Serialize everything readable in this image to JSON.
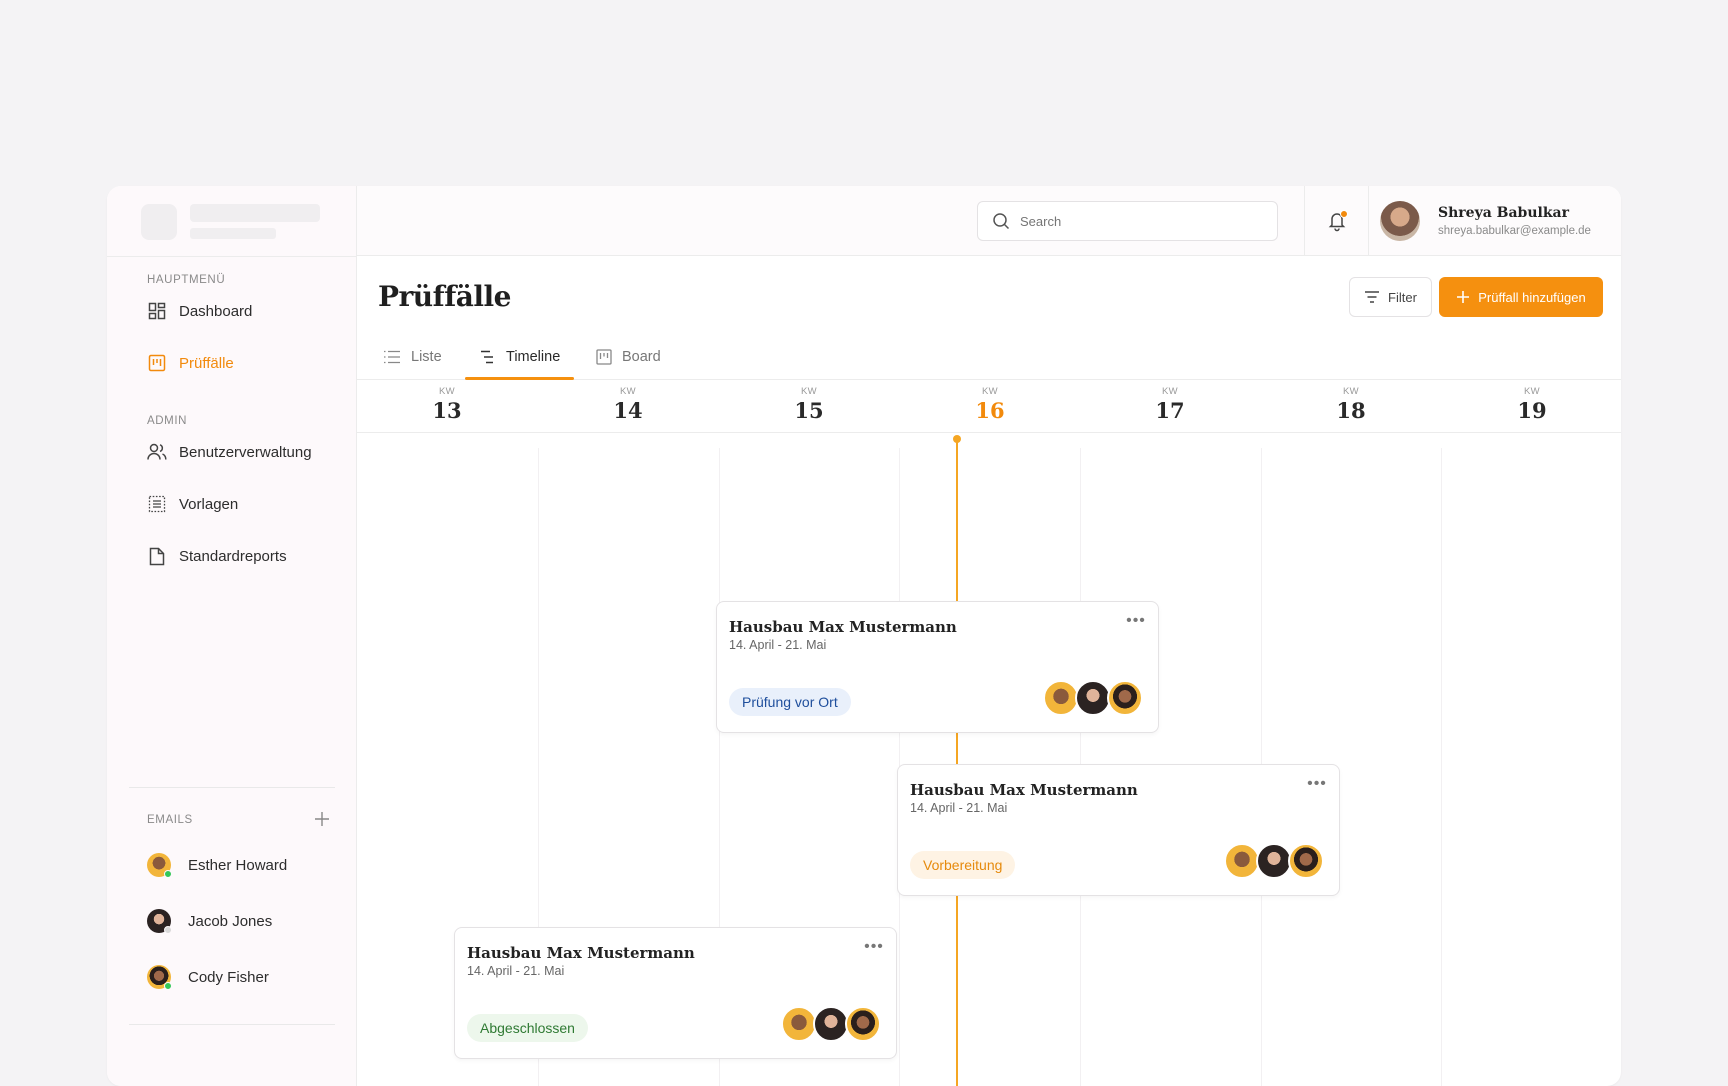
{
  "sidebar": {
    "main_menu_label": "HAUPTMENÜ",
    "admin_label": "ADMIN",
    "emails_label": "EMAILS",
    "nav": [
      {
        "label": "Dashboard",
        "icon": "dashboard-icon"
      },
      {
        "label": "Prüffälle",
        "icon": "cases-icon",
        "active": true
      },
      {
        "label": "Benutzerverwaltung",
        "icon": "users-icon"
      },
      {
        "label": "Vorlagen",
        "icon": "templates-icon"
      },
      {
        "label": "Standardreports",
        "icon": "document-icon"
      }
    ],
    "emails": [
      {
        "name": "Esther Howard",
        "status_color": "#34c759"
      },
      {
        "name": "Jacob Jones",
        "status_color": "#d9d9d9"
      },
      {
        "name": "Cody Fisher",
        "status_color": "#34c759"
      }
    ]
  },
  "header": {
    "search_placeholder": "Search",
    "user": {
      "name": "Shreya Babulkar",
      "email": "shreya.babulkar@example.de"
    },
    "notification_dot_color": "#f28a0c"
  },
  "page": {
    "title": "Prüffälle",
    "filter_label": "Filter",
    "add_label": "Prüffall hinzufügen",
    "tabs": [
      {
        "label": "Liste",
        "icon": "list-icon"
      },
      {
        "label": "Timeline",
        "icon": "timeline-icon",
        "active": true
      },
      {
        "label": "Board",
        "icon": "board-icon"
      }
    ]
  },
  "timeline": {
    "week_prefix": "KW",
    "weeks": [
      "13",
      "14",
      "15",
      "16",
      "17",
      "18",
      "19"
    ],
    "current_week": "16",
    "cards": [
      {
        "title": "Hausbau Max Mustermann",
        "date": "14. April - 21. Mai",
        "status": "Prüfung vor Ort",
        "status_style": "blue"
      },
      {
        "title": "Hausbau Max Mustermann",
        "date": "14. April - 21. Mai",
        "status": "Vorbereitung",
        "status_style": "orange"
      },
      {
        "title": "Hausbau Max Mustermann",
        "date": "14. April - 21. Mai",
        "status": "Abgeschlossen",
        "status_style": "green"
      }
    ]
  },
  "colors": {
    "accent": "#f5900f",
    "today_line": "#f5a623"
  }
}
